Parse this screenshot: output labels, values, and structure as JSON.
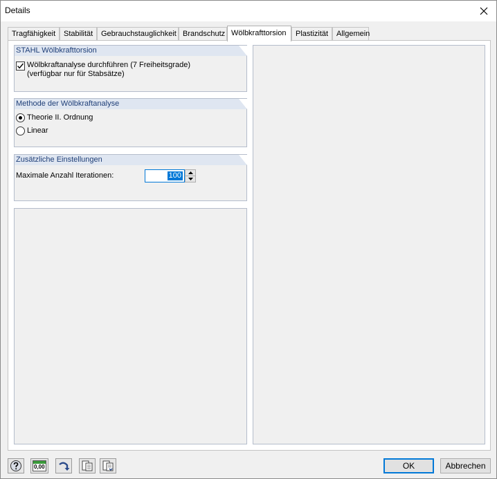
{
  "window": {
    "title": "Details"
  },
  "tabs": [
    {
      "label": "Tragfähigkeit"
    },
    {
      "label": "Stabilität"
    },
    {
      "label": "Gebrauchstauglichkeit"
    },
    {
      "label": "Brandschutz"
    },
    {
      "label": "Wölbkrafttorsion",
      "active": true
    },
    {
      "label": "Plastizität"
    },
    {
      "label": "Allgemein"
    }
  ],
  "group_steel": {
    "header": "STAHL Wölbkrafttorsion",
    "checkbox_label_line1": "Wölbkraftanalyse durchführen (7 Freiheitsgrade)",
    "checkbox_label_line2": "(verfügbar nur für Stabsätze)",
    "checked": true
  },
  "group_method": {
    "header": "Methode der Wölbkraftanalyse",
    "options": [
      {
        "label": "Theorie II. Ordnung",
        "selected": true
      },
      {
        "label": "Linear",
        "selected": false
      }
    ]
  },
  "group_settings": {
    "header": "Zusätzliche Einstellungen",
    "iterations_label": "Maximale Anzahl Iterationen:",
    "iterations_value": "100"
  },
  "footer": {
    "icons": [
      "help-icon",
      "units-icon",
      "arrow-icon",
      "export-icon",
      "import-icon"
    ],
    "units_icon_text": "0,00",
    "ok_label": "OK",
    "cancel_label": "Abbrechen"
  },
  "colors": {
    "group_header_bg": "#dfe6f1",
    "group_header_text": "#1f3f78",
    "accent": "#0078d7"
  }
}
